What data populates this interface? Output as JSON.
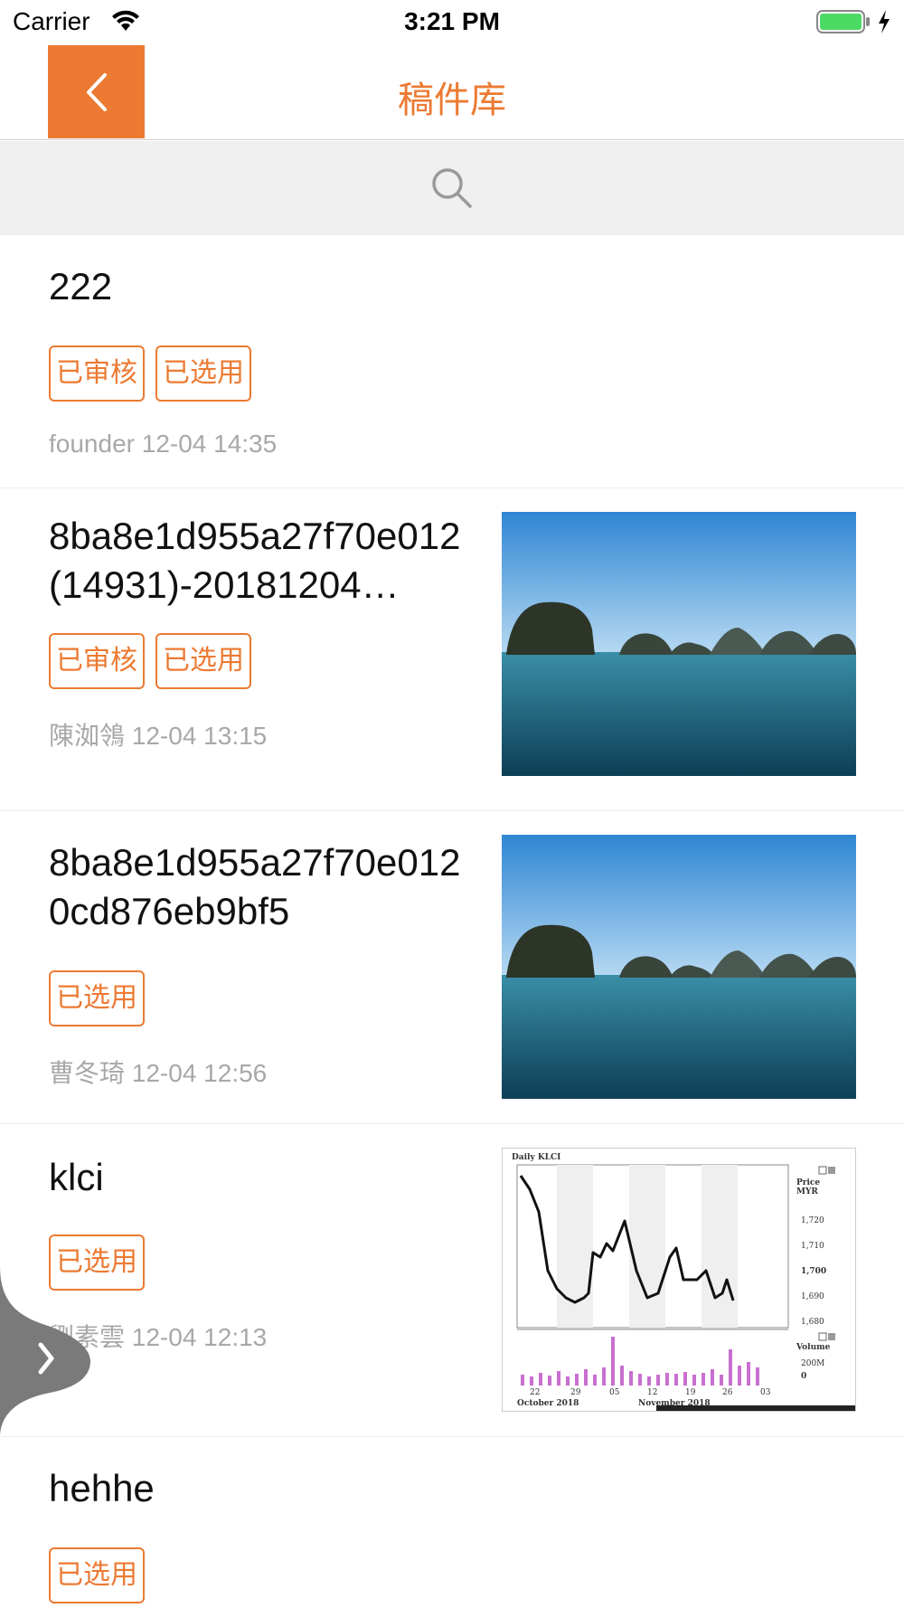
{
  "status_bar": {
    "carrier": "Carrier",
    "time": "3:21 PM"
  },
  "nav": {
    "title": "稿件库"
  },
  "search": {
    "icon": "search-icon"
  },
  "items": [
    {
      "title": "222",
      "tags": [
        "已审核",
        "已选用"
      ],
      "meta": "founder 12-04 14:35"
    },
    {
      "title": "8ba8e1d955a27f70e012(14931)-20181204…",
      "tags": [
        "已审核",
        "已选用"
      ],
      "meta": "陳洳鴒 12-04 13:15",
      "thumbnail": "seascape-photo"
    },
    {
      "title": "8ba8e1d955a27f70e0120cd876eb9bf5",
      "tags": [
        "已选用"
      ],
      "meta": "曹冬琦 12-04 12:56",
      "thumbnail": "seascape-photo"
    },
    {
      "title": "klci",
      "tags": [
        "已选用"
      ],
      "meta": "劉素雲 12-04 12:13",
      "thumbnail": "stock-chart-image",
      "thumb_chart": {
        "title": "Daily KLCI",
        "price_label": "Price",
        "unit_label": "MYR",
        "price_ticks": [
          "1,720",
          "1,710",
          "1,700",
          "1,690",
          "1,680"
        ],
        "volume_label": "Volume",
        "volume_ticks": [
          "200M",
          "0"
        ],
        "date_ticks": [
          "22",
          "29",
          "05",
          "12",
          "19",
          "26",
          "03"
        ],
        "month_labels": [
          "October 2018",
          "November 2018"
        ]
      }
    },
    {
      "title": "hehhe",
      "tags": [
        "已选用"
      ],
      "meta": ""
    }
  ],
  "colors": {
    "accent": "#ec7a32",
    "meta_text": "#a8a8a8",
    "search_bg": "#f0f0f0"
  }
}
